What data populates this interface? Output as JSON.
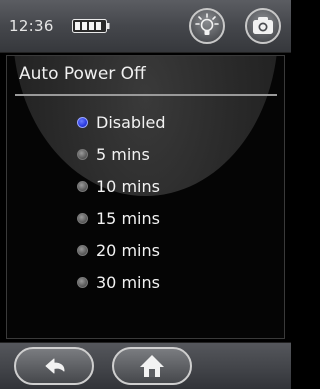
{
  "status": {
    "time": "12:36"
  },
  "settings": {
    "title": "Auto Power Off",
    "options": [
      {
        "label": "Disabled",
        "selected": true
      },
      {
        "label": "5 mins",
        "selected": false
      },
      {
        "label": "10 mins",
        "selected": false
      },
      {
        "label": "15 mins",
        "selected": false
      },
      {
        "label": "20 mins",
        "selected": false
      },
      {
        "label": "30 mins",
        "selected": false
      }
    ]
  },
  "icons": {
    "battery": "battery-icon",
    "flash": "flash-icon",
    "camera": "camera-icon",
    "back": "back-arrow-icon",
    "home": "home-icon"
  },
  "colors": {
    "selected_radio": "#2a3ae0",
    "bar_background": "#45474c",
    "panel_background": "#050505"
  }
}
